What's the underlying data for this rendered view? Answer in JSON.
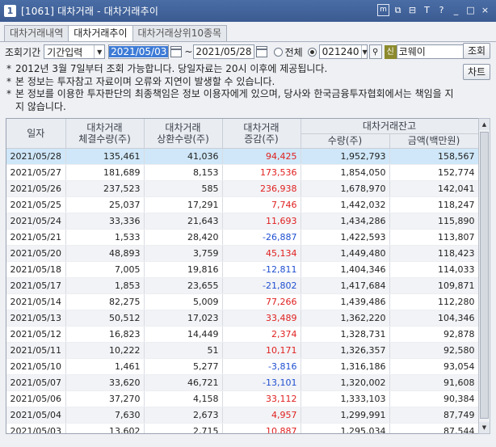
{
  "window": {
    "number": "1",
    "title": "[1061] 대차거래 - 대차거래추이",
    "buttons": [
      "m",
      "⧉",
      "⊟",
      "T",
      "?",
      "_",
      "□",
      "×"
    ]
  },
  "tabs": [
    {
      "label": "대차거래내역"
    },
    {
      "label": "대차거래추이"
    },
    {
      "label": "대차거래상위10종목"
    }
  ],
  "query": {
    "period_label": "조회기간",
    "period_mode": "기간입력",
    "date_from": "2021/05/03",
    "tilde": "~",
    "date_to": "2021/05/28",
    "radio_all_label": "전체",
    "stock_code": "021240",
    "sin_badge": "신",
    "stock_name": "코웨이",
    "search_button": "조회",
    "chart_button": "차트"
  },
  "notes": [
    "2012년 3월 7일부터 조회 가능합니다. 당일자료는 20시 이후에 제공됩니다.",
    "본 정보는 투자참고 자료이며 오류와 지연이 발생할 수 있습니다.",
    "본 정보를 이용한 투자판단의 최종책임은 정보 이용자에게 있으며, 당사와 한국금융투자협회에서는 책임을 지지 않습니다."
  ],
  "table": {
    "headers": {
      "date": "일자",
      "contract_1": "대차거래",
      "contract_2": "체결수량(주)",
      "repay_1": "대차거래",
      "repay_2": "상환수량(주)",
      "change_1": "대차거래",
      "change_2": "증감(주)",
      "balance": "대차거래잔고",
      "qty": "수량(주)",
      "amount": "금액(백만원)"
    },
    "rows": [
      {
        "date": "2021/05/28",
        "contract": "135,461",
        "repay": "41,036",
        "change": "94,425",
        "qty": "1,952,793",
        "amount": "158,567"
      },
      {
        "date": "2021/05/27",
        "contract": "181,689",
        "repay": "8,153",
        "change": "173,536",
        "qty": "1,854,050",
        "amount": "152,774"
      },
      {
        "date": "2021/05/26",
        "contract": "237,523",
        "repay": "585",
        "change": "236,938",
        "qty": "1,678,970",
        "amount": "142,041"
      },
      {
        "date": "2021/05/25",
        "contract": "25,037",
        "repay": "17,291",
        "change": "7,746",
        "qty": "1,442,032",
        "amount": "118,247"
      },
      {
        "date": "2021/05/24",
        "contract": "33,336",
        "repay": "21,643",
        "change": "11,693",
        "qty": "1,434,286",
        "amount": "115,890"
      },
      {
        "date": "2021/05/21",
        "contract": "1,533",
        "repay": "28,420",
        "change": "-26,887",
        "qty": "1,422,593",
        "amount": "113,807"
      },
      {
        "date": "2021/05/20",
        "contract": "48,893",
        "repay": "3,759",
        "change": "45,134",
        "qty": "1,449,480",
        "amount": "118,423"
      },
      {
        "date": "2021/05/18",
        "contract": "7,005",
        "repay": "19,816",
        "change": "-12,811",
        "qty": "1,404,346",
        "amount": "114,033"
      },
      {
        "date": "2021/05/17",
        "contract": "1,853",
        "repay": "23,655",
        "change": "-21,802",
        "qty": "1,417,684",
        "amount": "109,871"
      },
      {
        "date": "2021/05/14",
        "contract": "82,275",
        "repay": "5,009",
        "change": "77,266",
        "qty": "1,439,486",
        "amount": "112,280"
      },
      {
        "date": "2021/05/13",
        "contract": "50,512",
        "repay": "17,023",
        "change": "33,489",
        "qty": "1,362,220",
        "amount": "104,346"
      },
      {
        "date": "2021/05/12",
        "contract": "16,823",
        "repay": "14,449",
        "change": "2,374",
        "qty": "1,328,731",
        "amount": "92,878"
      },
      {
        "date": "2021/05/11",
        "contract": "10,222",
        "repay": "51",
        "change": "10,171",
        "qty": "1,326,357",
        "amount": "92,580"
      },
      {
        "date": "2021/05/10",
        "contract": "1,461",
        "repay": "5,277",
        "change": "-3,816",
        "qty": "1,316,186",
        "amount": "93,054"
      },
      {
        "date": "2021/05/07",
        "contract": "33,620",
        "repay": "46,721",
        "change": "-13,101",
        "qty": "1,320,002",
        "amount": "91,608"
      },
      {
        "date": "2021/05/06",
        "contract": "37,270",
        "repay": "4,158",
        "change": "33,112",
        "qty": "1,333,103",
        "amount": "90,384"
      },
      {
        "date": "2021/05/04",
        "contract": "7,630",
        "repay": "2,673",
        "change": "4,957",
        "qty": "1,299,991",
        "amount": "87,749"
      },
      {
        "date": "2021/05/03",
        "contract": "13,602",
        "repay": "2,715",
        "change": "10,887",
        "qty": "1,295,034",
        "amount": "87,544"
      }
    ]
  },
  "colors": {
    "positive": "#e02020",
    "negative": "#1f4fd1",
    "selected_row": "#cfe7f8"
  }
}
